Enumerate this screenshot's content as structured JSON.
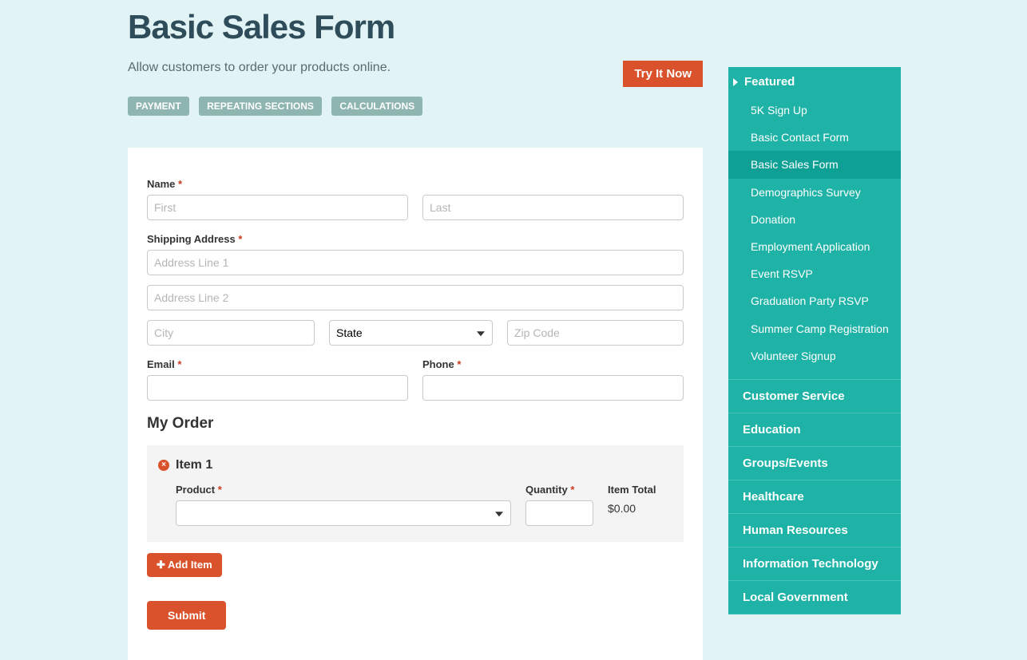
{
  "header": {
    "title": "Basic Sales Form",
    "subtitle": "Allow customers to order your products online.",
    "try_label": "Try It Now"
  },
  "tags": [
    "PAYMENT",
    "REPEATING SECTIONS",
    "CALCULATIONS"
  ],
  "form": {
    "name_label": "Name",
    "first_ph": "First",
    "last_ph": "Last",
    "ship_label": "Shipping Address",
    "addr1_ph": "Address Line 1",
    "addr2_ph": "Address Line 2",
    "city_ph": "City",
    "state_default": "State",
    "zip_ph": "Zip Code",
    "email_label": "Email",
    "phone_label": "Phone",
    "order_heading": "My Order",
    "item_title": "Item 1",
    "product_label": "Product",
    "qty_label": "Quantity",
    "total_label": "Item Total",
    "total_value": "$0.00",
    "add_item_label": "Add Item",
    "submit_label": "Submit"
  },
  "sidebar": {
    "featured_label": "Featured",
    "featured_items": [
      "5K Sign Up",
      "Basic Contact Form",
      "Basic Sales Form",
      "Demographics Survey",
      "Donation",
      "Employment Application",
      "Event RSVP",
      "Graduation Party RSVP",
      "Summer Camp Registration",
      "Volunteer Signup"
    ],
    "active_index": 2,
    "categories": [
      "Customer Service",
      "Education",
      "Groups/Events",
      "Healthcare",
      "Human Resources",
      "Information Technology",
      "Local Government"
    ]
  }
}
